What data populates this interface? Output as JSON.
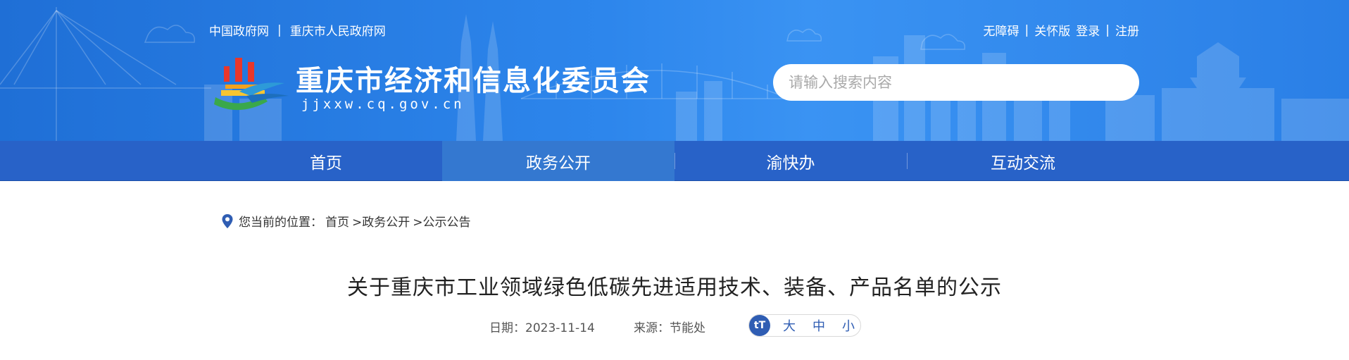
{
  "header": {
    "top_links": [
      "中国政府网",
      "重庆市人民政府网"
    ],
    "top_link_separator": "|",
    "top_right": [
      "无障碍",
      "|",
      "关怀版",
      "登录",
      "|",
      "注册"
    ],
    "site_title": "重庆市经济和信息化委员会",
    "site_domain": "jjxxw.cq.gov.cn",
    "search_placeholder": "请输入搜索内容"
  },
  "nav": {
    "items": [
      "首页",
      "政务公开",
      "渝快办",
      "互动交流"
    ],
    "active_index": 1
  },
  "breadcrumb": {
    "prefix": "您当前的位置：",
    "items": [
      "首页",
      ">政务公开",
      ">公示公告"
    ]
  },
  "article": {
    "title": "关于重庆市工业领域绿色低碳先进适用技术、装备、产品名单的公示",
    "date_label": "日期：",
    "date": "2023-11-14",
    "source_label": "来源：",
    "source": "节能处",
    "font_sizes": [
      "大",
      "中",
      "小"
    ],
    "font_icon": "tT"
  },
  "colors": {
    "banner": "#2d86ec",
    "nav": "#2862c8",
    "nav_active": "#3478d0",
    "accent": "#2f5db3"
  },
  "icons": [
    "emblem-logo",
    "location-pin-icon",
    "font-size-icon"
  ]
}
